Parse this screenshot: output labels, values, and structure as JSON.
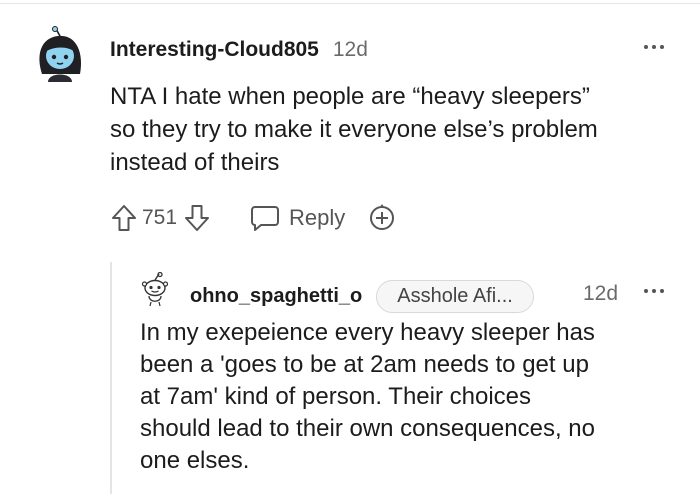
{
  "comment": {
    "author": "Interesting-Cloud805",
    "time": "12d",
    "body_lines": [
      "NTA I hate when people are “heavy sleepers”",
      "so they try to make it everyone else’s problem",
      "instead of theirs"
    ],
    "score": "751",
    "reply_label": "Reply",
    "icons": [
      "upvote-icon",
      "downvote-icon",
      "reply-icon",
      "award-icon",
      "more-icon"
    ]
  },
  "reply": {
    "author": "ohno_spaghetti_o",
    "flair": "Asshole Afi...",
    "time": "12d",
    "body_lines": [
      "In my exepeience every heavy sleeper has",
      "been a 'goes to be at 2am needs to get up",
      "at 7am' kind of person. Their choices",
      "should lead to their own consequences, no",
      "one elses."
    ]
  },
  "colors": {
    "text": "#1c1c1c",
    "muted": "#6b6b6b",
    "icon": "#555555",
    "avatar_accent": "#8fd3f0"
  }
}
